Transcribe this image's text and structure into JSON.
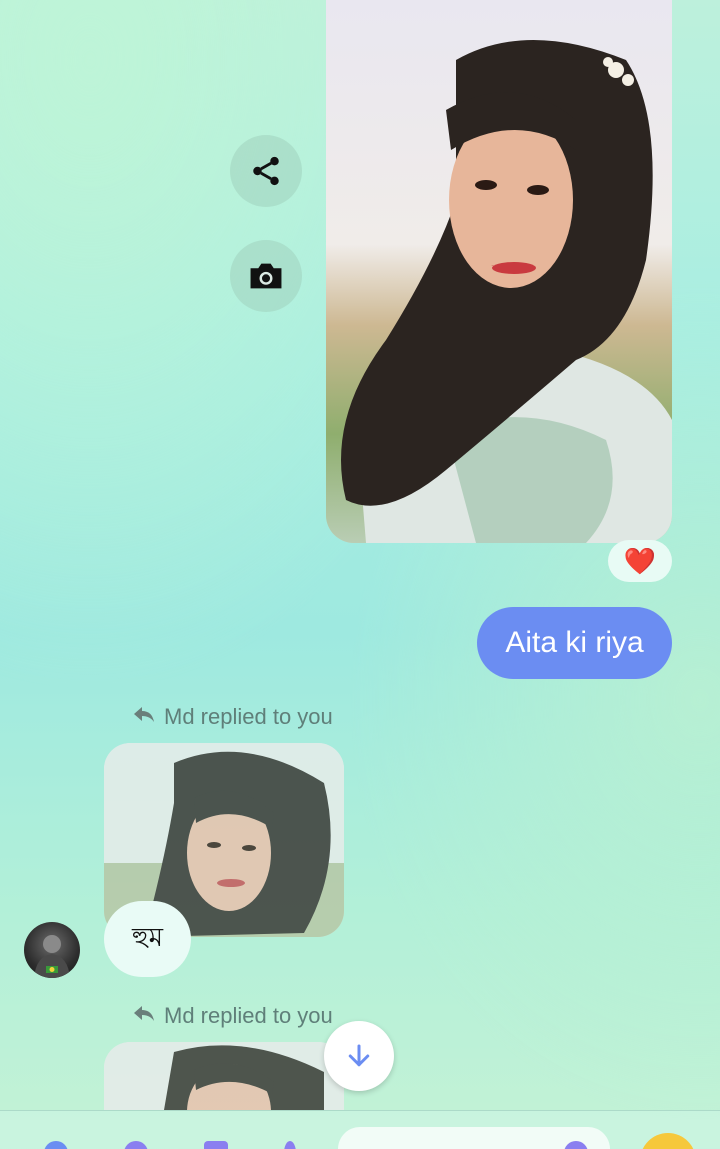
{
  "messages": {
    "outgoing_text": "Aita ki riya",
    "incoming_text": "হুম",
    "reaction_emoji": "❤️",
    "reply_label_1": "Md replied to you",
    "reply_label_2": "Md replied to you",
    "reply_arrow": "➦"
  },
  "icons": {
    "share": "share-icon",
    "camera": "camera-icon",
    "scroll_down": "arrow-down-icon",
    "reply": "reply-icon"
  },
  "colors": {
    "outgoing_bubble": "#6b8df2",
    "incoming_bubble": "#e9fbf6",
    "accent": "#6b8df2"
  }
}
